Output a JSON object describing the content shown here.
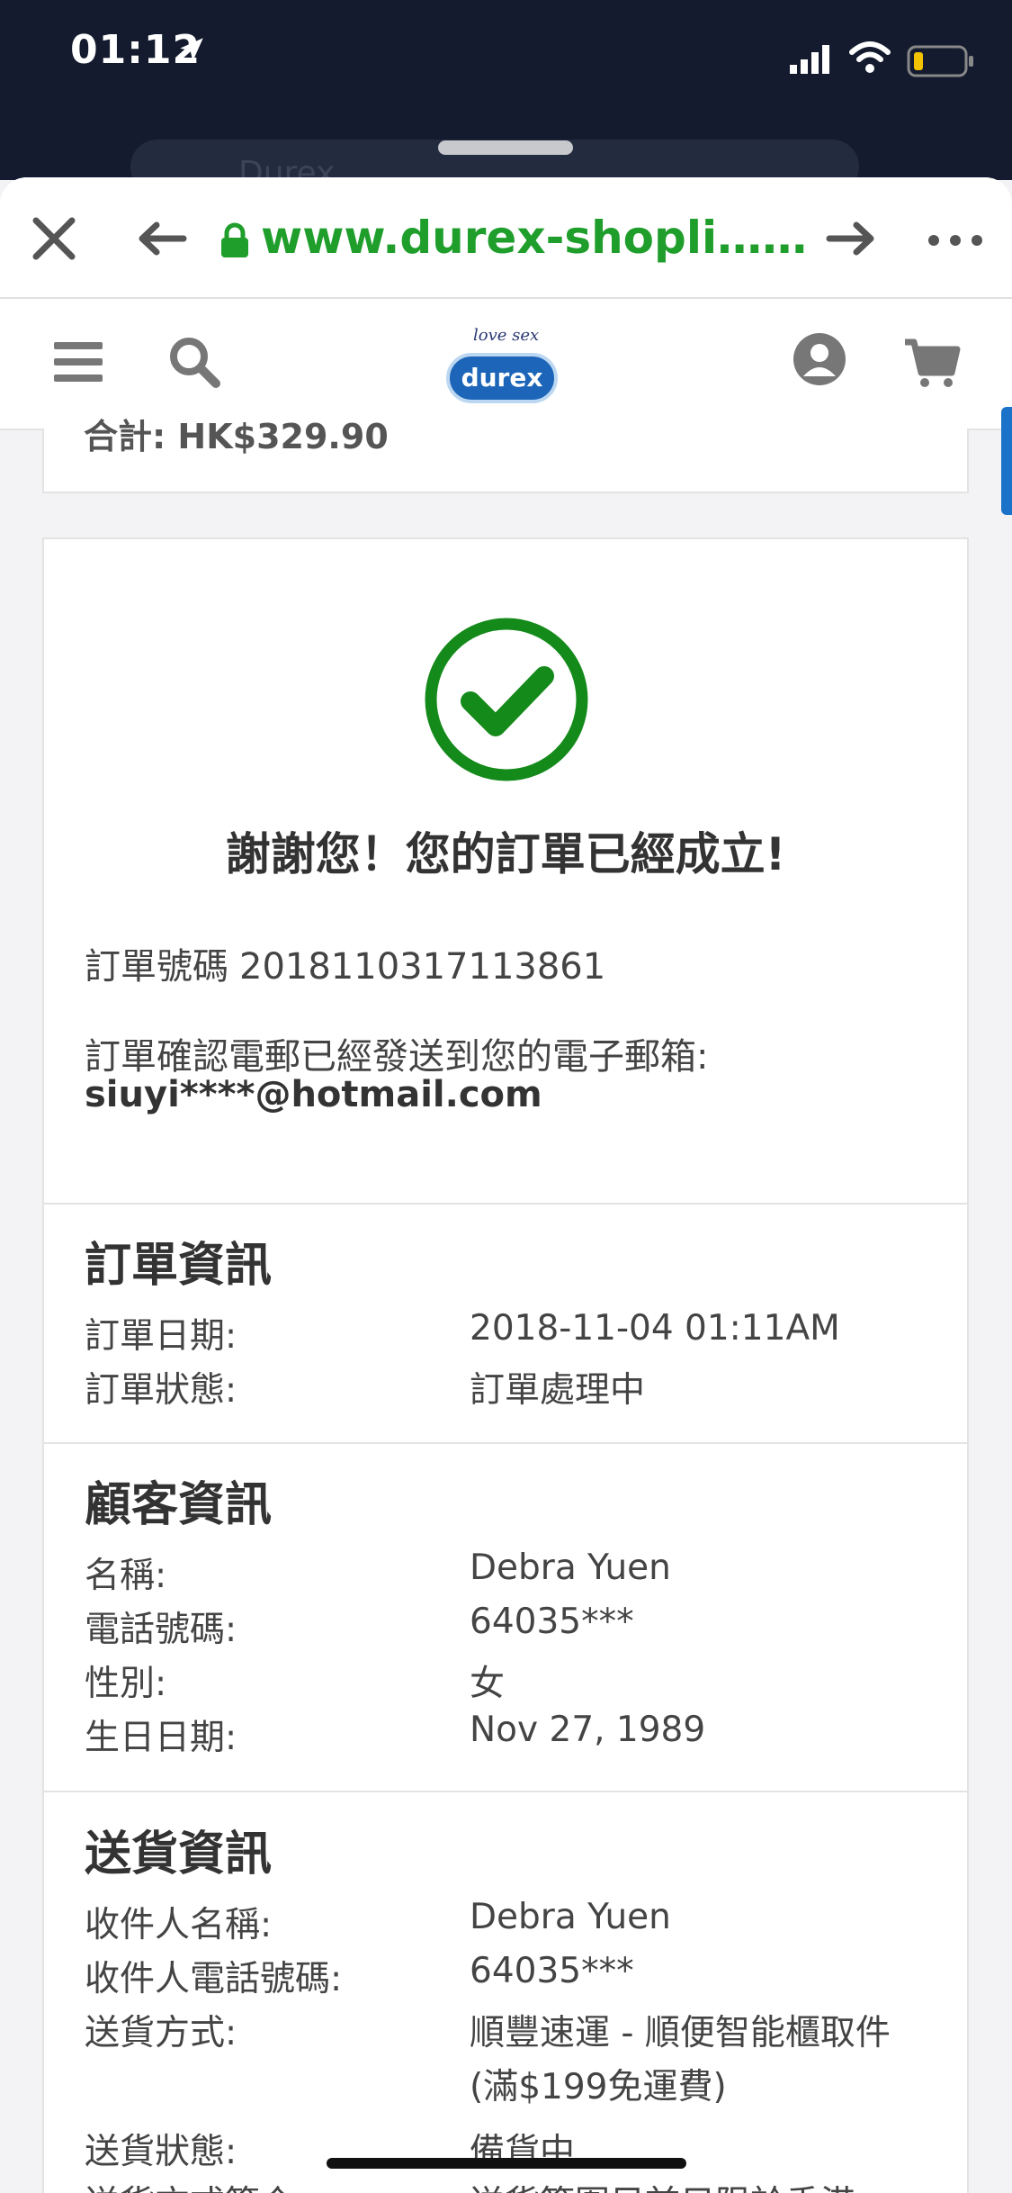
{
  "status_bar": {
    "time": "01:12"
  },
  "background_tab": {
    "search_text": "Durex"
  },
  "browser": {
    "url": "www.durex-shopli……"
  },
  "header": {
    "logo_tagline": "love sex",
    "logo_text": "durex"
  },
  "previous_card": {
    "text": "合計: HK$329.90"
  },
  "confirmation": {
    "thanks": "謝謝您！您的訂單已經成立!",
    "order_number_label": "訂單號碼",
    "order_number": "2018110317113861",
    "email_notice": "訂單確認電郵已經發送到您的電子郵箱:",
    "email": "siuyi****@hotmail.com"
  },
  "order_info": {
    "title": "訂單資訊",
    "rows": [
      {
        "label": "訂單日期:",
        "value": "2018-11-04 01:11AM"
      },
      {
        "label": "訂單狀態:",
        "value": "訂單處理中"
      }
    ]
  },
  "customer_info": {
    "title": "顧客資訊",
    "rows": [
      {
        "label": "名稱:",
        "value": "Debra Yuen"
      },
      {
        "label": "電話號碼:",
        "value": "64035***"
      },
      {
        "label": "性別:",
        "value": "女"
      },
      {
        "label": "生日日期:",
        "value": "Nov 27, 1989"
      }
    ]
  },
  "delivery_info": {
    "title": "送貨資訊",
    "rows": [
      {
        "label": "收件人名稱:",
        "value": "Debra Yuen"
      },
      {
        "label": "收件人電話號碼:",
        "value": "64035***"
      },
      {
        "label": "送貨方式:",
        "value": "順豐速運 - 順便智能櫃取件",
        "value2": "(滿$199免運費)"
      },
      {
        "label": "送貨狀態:",
        "value": "備貨中"
      },
      {
        "label": "送貨方式簡介:",
        "value": "送貨範圍目前只限於香港"
      }
    ]
  },
  "colors": {
    "status_bar": "#141b2e",
    "url_green": "#1f9e2c",
    "success_green": "#148a1a",
    "brand_blue": "#1c65b8"
  }
}
